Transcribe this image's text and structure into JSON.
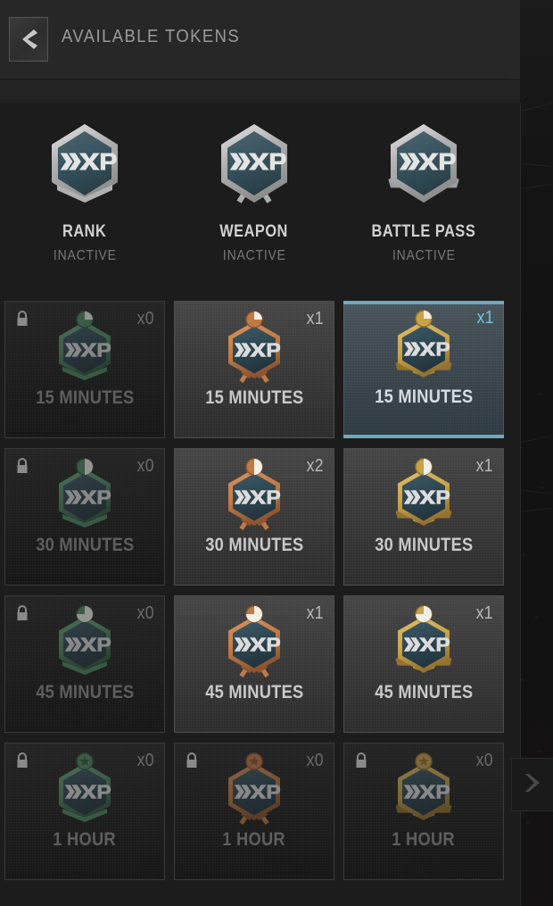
{
  "header": {
    "title": "AVAILABLE TOKENS",
    "back_icon": "chevron-left-icon",
    "forward_icon": "chevron-right-icon"
  },
  "colors": {
    "accent_selected": "#6fa9bf",
    "accent_selected_text": "#6fc5e0",
    "rank_badge": "#4f8a63",
    "weapon_badge": "#c07a45",
    "battlepass_badge": "#c9a martin",
    "panel_bg": "#1c1c1c",
    "header_bg": "#272727",
    "card_bg": "#3a3a3a",
    "card_locked_bg": "#1e1e1e"
  },
  "columns": [
    {
      "id": "rank",
      "title": "RANK",
      "status": "INACTIVE",
      "badge_icon": "xp-hexagon-rank-icon",
      "badge_color": "#4f8a63"
    },
    {
      "id": "weapon",
      "title": "WEAPON",
      "status": "INACTIVE",
      "badge_icon": "xp-hexagon-weapon-icon",
      "badge_color": "#c07a45"
    },
    {
      "id": "battle_pass",
      "title": "BATTLE PASS",
      "status": "INACTIVE",
      "badge_icon": "xp-hexagon-battlepass-icon",
      "badge_color": "#c9a24a"
    }
  ],
  "tokens": [
    [
      {
        "label": "15 MINUTES",
        "count": "x0",
        "locked": true,
        "selected": false,
        "type": "rank",
        "fill": 0.25,
        "lock_icon": "padlock-icon"
      },
      {
        "label": "15 MINUTES",
        "count": "x1",
        "locked": false,
        "selected": false,
        "type": "weapon",
        "fill": 0.25,
        "lock_icon": null
      },
      {
        "label": "15 MINUTES",
        "count": "x1",
        "locked": false,
        "selected": true,
        "type": "battle_pass",
        "fill": 0.25,
        "lock_icon": null
      }
    ],
    [
      {
        "label": "30 MINUTES",
        "count": "x0",
        "locked": true,
        "selected": false,
        "type": "rank",
        "fill": 0.5,
        "lock_icon": "padlock-icon"
      },
      {
        "label": "30 MINUTES",
        "count": "x2",
        "locked": false,
        "selected": false,
        "type": "weapon",
        "fill": 0.5,
        "lock_icon": null
      },
      {
        "label": "30 MINUTES",
        "count": "x1",
        "locked": false,
        "selected": false,
        "type": "battle_pass",
        "fill": 0.5,
        "lock_icon": null
      }
    ],
    [
      {
        "label": "45 MINUTES",
        "count": "x0",
        "locked": true,
        "selected": false,
        "type": "rank",
        "fill": 0.75,
        "lock_icon": "padlock-icon"
      },
      {
        "label": "45 MINUTES",
        "count": "x1",
        "locked": false,
        "selected": false,
        "type": "weapon",
        "fill": 0.75,
        "lock_icon": null
      },
      {
        "label": "45 MINUTES",
        "count": "x1",
        "locked": false,
        "selected": false,
        "type": "battle_pass",
        "fill": 0.75,
        "lock_icon": null
      }
    ],
    [
      {
        "label": "1 HOUR",
        "count": "x0",
        "locked": true,
        "selected": false,
        "type": "rank",
        "fill": 1,
        "lock_icon": "padlock-icon"
      },
      {
        "label": "1 HOUR",
        "count": "x0",
        "locked": true,
        "selected": false,
        "type": "weapon",
        "fill": 1,
        "lock_icon": "padlock-icon"
      },
      {
        "label": "1 HOUR",
        "count": "x0",
        "locked": true,
        "selected": false,
        "type": "battle_pass",
        "fill": 1,
        "lock_icon": "padlock-icon"
      }
    ]
  ]
}
